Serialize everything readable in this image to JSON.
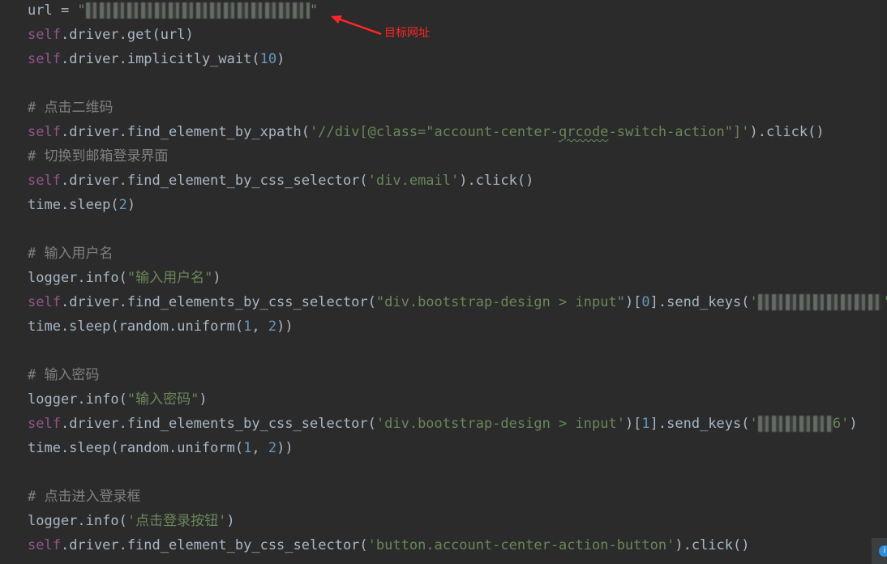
{
  "annotation": {
    "label": "目标网址",
    "color": "#ff2626"
  },
  "colors": {
    "background": "#2b2b2b",
    "default_text": "#a9b7c6",
    "self_keyword": "#94558d",
    "number": "#6897bb",
    "string": "#6a8759",
    "comment": "#808080"
  },
  "code_lines": [
    [
      {
        "t": "def",
        "v": "url = "
      },
      {
        "t": "str",
        "v": "\""
      },
      {
        "t": "blur",
        "v": "https://xxxxxxxxxxxxx/login"
      },
      {
        "t": "str",
        "v": "\""
      }
    ],
    [
      {
        "t": "self",
        "v": "self"
      },
      {
        "t": "def",
        "v": ".driver.get(url)"
      }
    ],
    [
      {
        "t": "self",
        "v": "self"
      },
      {
        "t": "def",
        "v": ".driver.implicitly_wait("
      },
      {
        "t": "num",
        "v": "10"
      },
      {
        "t": "def",
        "v": ")"
      }
    ],
    [],
    [
      {
        "t": "cmt",
        "v": "# 点击二维码"
      }
    ],
    [
      {
        "t": "self",
        "v": "self"
      },
      {
        "t": "def",
        "v": ".driver.find_element_by_xpath("
      },
      {
        "t": "str",
        "v": "'//div[@class=\"account-center-"
      },
      {
        "t": "str",
        "s": true,
        "v": "qrcode"
      },
      {
        "t": "str",
        "v": "-switch-action\"]'"
      },
      {
        "t": "def",
        "v": ").click()"
      }
    ],
    [
      {
        "t": "cmt",
        "v": "# 切换到邮箱登录界面"
      }
    ],
    [
      {
        "t": "self",
        "v": "self"
      },
      {
        "t": "def",
        "v": ".driver.find_element_by_css_selector("
      },
      {
        "t": "str",
        "v": "'div.email'"
      },
      {
        "t": "def",
        "v": ").click()"
      }
    ],
    [
      {
        "t": "def",
        "v": "time.sleep("
      },
      {
        "t": "num",
        "v": "2"
      },
      {
        "t": "def",
        "v": ")"
      }
    ],
    [],
    [
      {
        "t": "cmt",
        "v": "# 输入用户名"
      }
    ],
    [
      {
        "t": "def",
        "v": "logger.info("
      },
      {
        "t": "str",
        "v": "\"输入用户名\""
      },
      {
        "t": "def",
        "v": ")"
      }
    ],
    [
      {
        "t": "self",
        "v": "self"
      },
      {
        "t": "def",
        "v": ".driver.find_elements_by_css_selector("
      },
      {
        "t": "str",
        "v": "\"div.bootstrap-design > input\""
      },
      {
        "t": "def",
        "v": ")["
      },
      {
        "t": "num",
        "v": "0"
      },
      {
        "t": "def",
        "v": "].send_keys("
      },
      {
        "t": "str",
        "v": "'"
      },
      {
        "t": "blur",
        "v": "xxxxxxxxxxxxxxx"
      },
      {
        "t": "str",
        "v": "'"
      },
      {
        "t": "def",
        "v": ")"
      }
    ],
    [
      {
        "t": "def",
        "v": "time.sleep(random.uniform("
      },
      {
        "t": "num",
        "v": "1"
      },
      {
        "t": "def",
        "v": ", "
      },
      {
        "t": "num",
        "v": "2"
      },
      {
        "t": "def",
        "v": "))"
      }
    ],
    [],
    [
      {
        "t": "cmt",
        "v": "# 输入密码"
      }
    ],
    [
      {
        "t": "def",
        "v": "logger.info("
      },
      {
        "t": "str",
        "v": "\"输入密码\""
      },
      {
        "t": "def",
        "v": ")"
      }
    ],
    [
      {
        "t": "self",
        "v": "self"
      },
      {
        "t": "def",
        "v": ".driver.find_elements_by_css_selector("
      },
      {
        "t": "str",
        "v": "'div.bootstrap-design > input'"
      },
      {
        "t": "def",
        "v": ")["
      },
      {
        "t": "num",
        "v": "1"
      },
      {
        "t": "def",
        "v": "].send_keys("
      },
      {
        "t": "str",
        "v": "'"
      },
      {
        "t": "blur",
        "v": "xxxxxxxxx"
      },
      {
        "t": "str",
        "v": "6'"
      },
      {
        "t": "def",
        "v": ")"
      }
    ],
    [
      {
        "t": "def",
        "v": "time.sleep(random.uniform("
      },
      {
        "t": "num",
        "v": "1"
      },
      {
        "t": "def",
        "v": ", "
      },
      {
        "t": "num",
        "v": "2"
      },
      {
        "t": "def",
        "v": "))"
      }
    ],
    [],
    [
      {
        "t": "cmt",
        "v": "# 点击进入登录框"
      }
    ],
    [
      {
        "t": "def",
        "v": "logger.info("
      },
      {
        "t": "str",
        "v": "'点击登录按钮'"
      },
      {
        "t": "def",
        "v": ")"
      }
    ],
    [
      {
        "t": "self",
        "v": "self"
      },
      {
        "t": "def",
        "v": ".driver.find_element_by_css_selector("
      },
      {
        "t": "str",
        "v": "'button.account-center-action-button'"
      },
      {
        "t": "def",
        "v": ").click()"
      }
    ]
  ],
  "status_icon": "notification-icon"
}
